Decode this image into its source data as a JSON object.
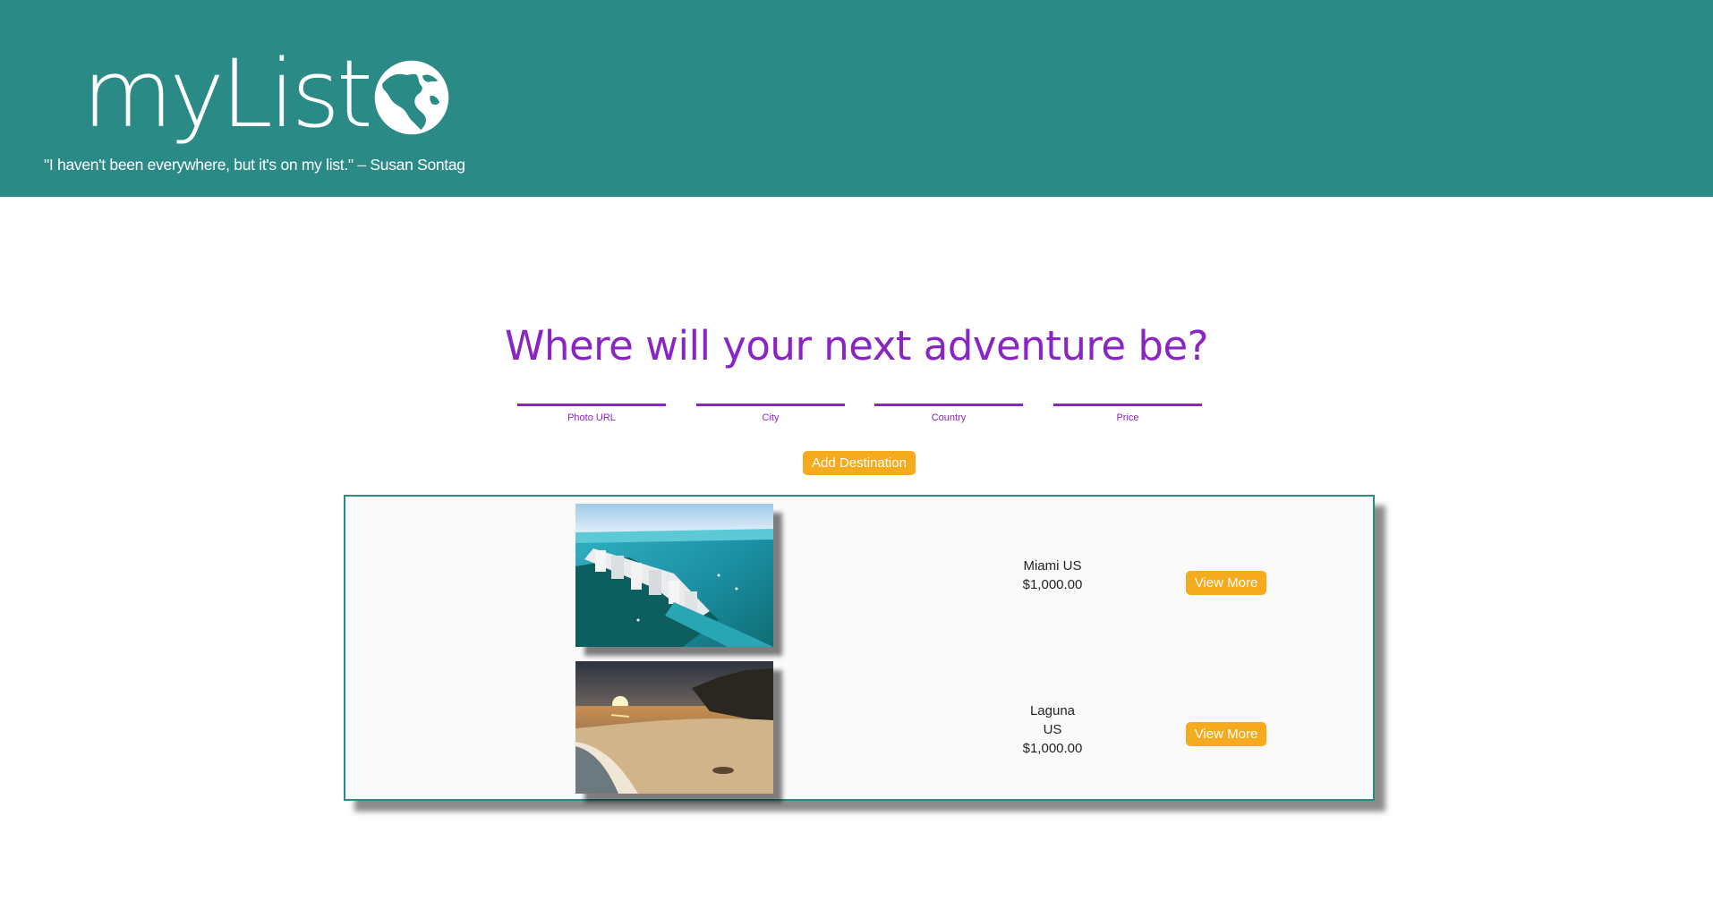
{
  "header": {
    "logo_text": "myList",
    "logo_icon": "globe-icon",
    "quote": "\"I haven't been everywhere, but it's on my list.\" – Susan Sontag",
    "background_color": "#2a8a85"
  },
  "main": {
    "headline": "Where will your next adventure be?",
    "accent_color": "#8a24c4",
    "form": {
      "fields": [
        {
          "label": "Photo URL",
          "value": ""
        },
        {
          "label": "City",
          "value": ""
        },
        {
          "label": "Country",
          "value": ""
        },
        {
          "label": "Price",
          "value": ""
        }
      ],
      "add_button_label": "Add Destination",
      "button_color": "#f6ab1e"
    },
    "destinations": [
      {
        "city_country": "Miami US",
        "price": "$1,000.00",
        "photo": "miami-beach-aerial-photo",
        "view_more_label": "View More"
      },
      {
        "city": "Laguna",
        "country": "US",
        "price": "$1,000.00",
        "photo": "laguna-sunset-beach-photo",
        "view_more_label": "View More"
      }
    ]
  }
}
